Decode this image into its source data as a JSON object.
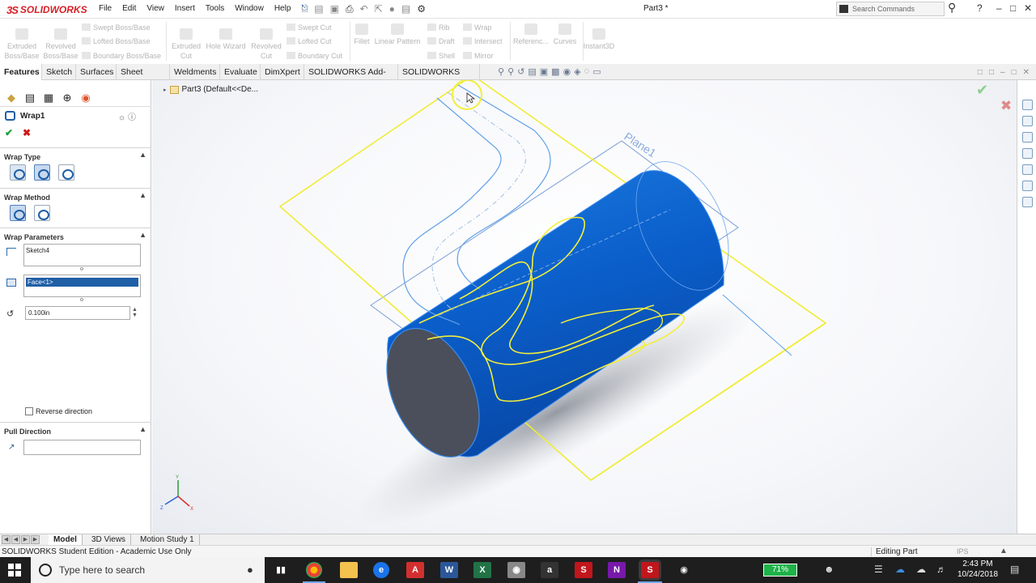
{
  "app": {
    "logo_text": "SOLIDWORKS",
    "document_title": "Part3 *"
  },
  "menu": [
    "File",
    "Edit",
    "View",
    "Insert",
    "Tools",
    "Window",
    "Help"
  ],
  "search": {
    "placeholder": "Search Commands"
  },
  "ribbon": {
    "extruded_boss": "Extruded Boss/Base",
    "revolved_boss": "Revolved Boss/Base",
    "swept_boss": "Swept Boss/Base",
    "lofted_boss": "Lofted Boss/Base",
    "boundary_boss": "Boundary Boss/Base",
    "extruded_cut": "Extruded Cut",
    "hole_wizard": "Hole Wizard",
    "revolved_cut": "Revolved Cut",
    "swept_cut": "Swept Cut",
    "lofted_cut": "Lofted Cut",
    "boundary_cut": "Boundary Cut",
    "fillet": "Fillet",
    "linear_pattern": "Linear Pattern",
    "rib": "Rib",
    "draft": "Draft",
    "shell": "Shell",
    "wrap": "Wrap",
    "intersect": "Intersect",
    "mirror": "Mirror",
    "reference": "Referenc...",
    "curves": "Curves",
    "instant3d": "Instant3D"
  },
  "tabs": [
    "Features",
    "Sketch",
    "Surfaces",
    "Sheet Metal",
    "Weldments",
    "Evaluate",
    "DimXpert",
    "SOLIDWORKS Add-Ins",
    "SOLIDWORKS MBD"
  ],
  "tree": {
    "root": "Part3  (Default<<De..."
  },
  "property_manager": {
    "title": "Wrap1",
    "sections": {
      "wrap_type": "Wrap Type",
      "wrap_method": "Wrap Method",
      "wrap_parameters": "Wrap Parameters",
      "pull_direction": "Pull Direction"
    },
    "sketch_field": "Sketch4",
    "face_field": "Face<1>",
    "thickness": "0.100in",
    "reverse_direction": "Reverse direction",
    "pull_value": ""
  },
  "viewport": {
    "plane_label": "Plane1"
  },
  "bottom_tabs": [
    "Model",
    "3D Views",
    "Motion Study 1"
  ],
  "status": {
    "left": "SOLIDWORKS Student Edition - Academic Use Only",
    "mode": "Editing Part",
    "units": "IPS"
  },
  "taskbar": {
    "search_placeholder": "Type here to search",
    "battery": "71%",
    "time": "2:43 PM",
    "date": "10/24/2018"
  },
  "colors": {
    "body_blue": "#0d5fc8",
    "sketch_yellow": "#f3ef3a",
    "plane_blue": "#7c9fd4",
    "accent_red": "#d71f26"
  }
}
